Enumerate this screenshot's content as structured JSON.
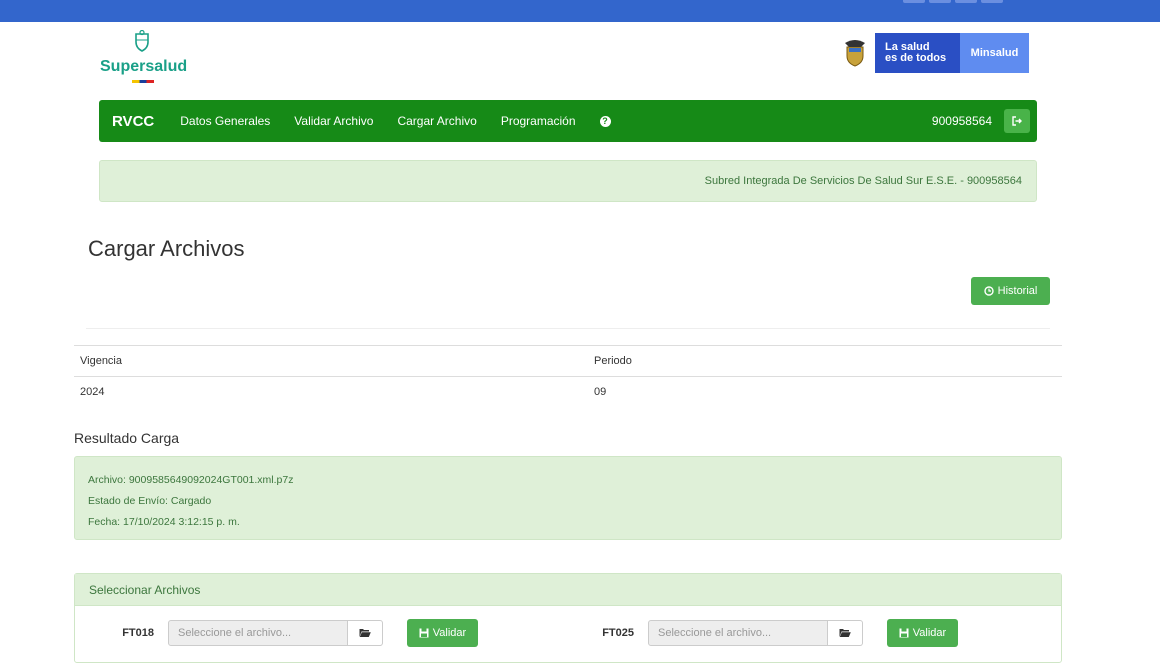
{
  "logo": {
    "brand": "Supersalud"
  },
  "gov": {
    "line1": "La salud",
    "line2": "es de todos",
    "ministry": "Minsalud"
  },
  "navbar": {
    "brand": "RVCC",
    "items": [
      {
        "label": "Datos Generales"
      },
      {
        "label": "Validar Archivo"
      },
      {
        "label": "Cargar Archivo"
      },
      {
        "label": "Programación"
      }
    ],
    "help_icon": "question-circle-icon",
    "user": "900958564",
    "logout_icon": "sign-out-icon"
  },
  "info": {
    "entity": "Subred Integrada De Servicios De Salud Sur E.S.E. - 900958564"
  },
  "page": {
    "title": "Cargar Archivos",
    "history_label": "Historial",
    "history_icon": "clock-icon"
  },
  "table": {
    "headers": {
      "vigencia": "Vigencia",
      "periodo": "Periodo"
    },
    "row": {
      "vigencia": "2024",
      "periodo": "09"
    }
  },
  "result": {
    "title": "Resultado Carga",
    "archivo": "Archivo: 9009585649092024GT001.xml.p7z",
    "estado": "Estado de Envío: Cargado",
    "fecha": "Fecha: 17/10/2024 3:12:15 p. m."
  },
  "select_files": {
    "title": "Seleccionar Archivos",
    "files": [
      {
        "code": "FT018",
        "placeholder": "Seleccione el archivo...",
        "button": "Validar"
      },
      {
        "code": "FT025",
        "placeholder": "Seleccione el archivo...",
        "button": "Validar"
      }
    ]
  },
  "colors": {
    "topbar": "#3366cc",
    "navbar": "#168a17",
    "success_bg": "#dff0d8",
    "button_green": "#4caf50"
  }
}
